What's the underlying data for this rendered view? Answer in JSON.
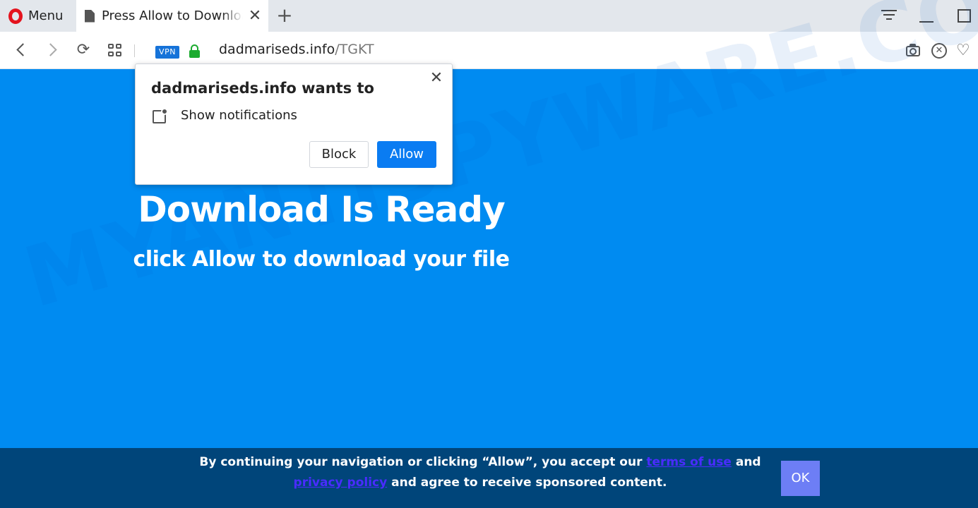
{
  "browser": {
    "menu_label": "Menu",
    "tab_title": "Press Allow to Download",
    "tab_close": "✕",
    "new_tab": "+",
    "vpn_badge": "VPN",
    "url_domain": "dadmariseds.info",
    "url_path": "/TGKT"
  },
  "popup": {
    "title": "dadmariseds.info wants to",
    "permission": "Show notifications",
    "block_label": "Block",
    "allow_label": "Allow",
    "close": "✕"
  },
  "page": {
    "headline": "Download Is Ready",
    "subline": "click Allow to download your file",
    "watermark": "MYANTISPYWARE.COM"
  },
  "consent": {
    "text_before": "By continuing your navigation or clicking “Allow”, you accept our ",
    "terms_link": "terms of use",
    "text_middle": " and ",
    "privacy_link": "privacy policy",
    "text_after": " and agree to receive sponsored content.",
    "ok_label": "OK"
  },
  "colors": {
    "page_bg": "#008bf1",
    "consent_bg": "#00457a",
    "allow_button": "#0a7cf2",
    "ok_button": "#6d7ef5",
    "link": "#4a2cff",
    "lock": "#1bab2f",
    "opera_red": "#e4141e"
  }
}
